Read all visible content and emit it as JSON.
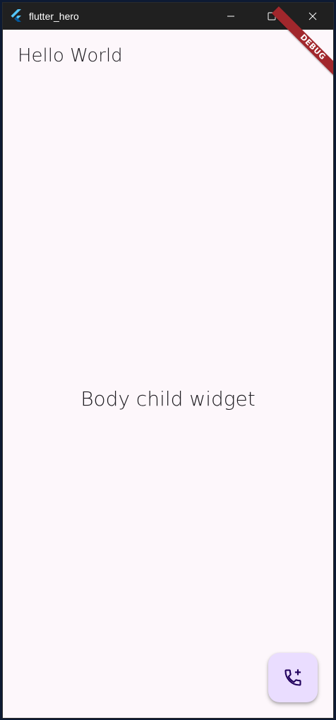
{
  "window": {
    "title": "flutter_hero",
    "app_icon": "flutter-logo-icon",
    "controls": {
      "minimize_icon": "minimize-icon",
      "maximize_icon": "maximize-icon",
      "close_icon": "close-icon"
    }
  },
  "app_bar": {
    "title": "Hello World"
  },
  "body": {
    "text": "Body child widget"
  },
  "debug_banner": {
    "label": "DEBUG",
    "color": "#a1272c"
  },
  "fab": {
    "icon": "add-call-icon",
    "background": "#eaddff"
  },
  "colors": {
    "surface": "#fdf7fb",
    "on_surface": "#1d1b20",
    "titlebar": "#202020"
  }
}
